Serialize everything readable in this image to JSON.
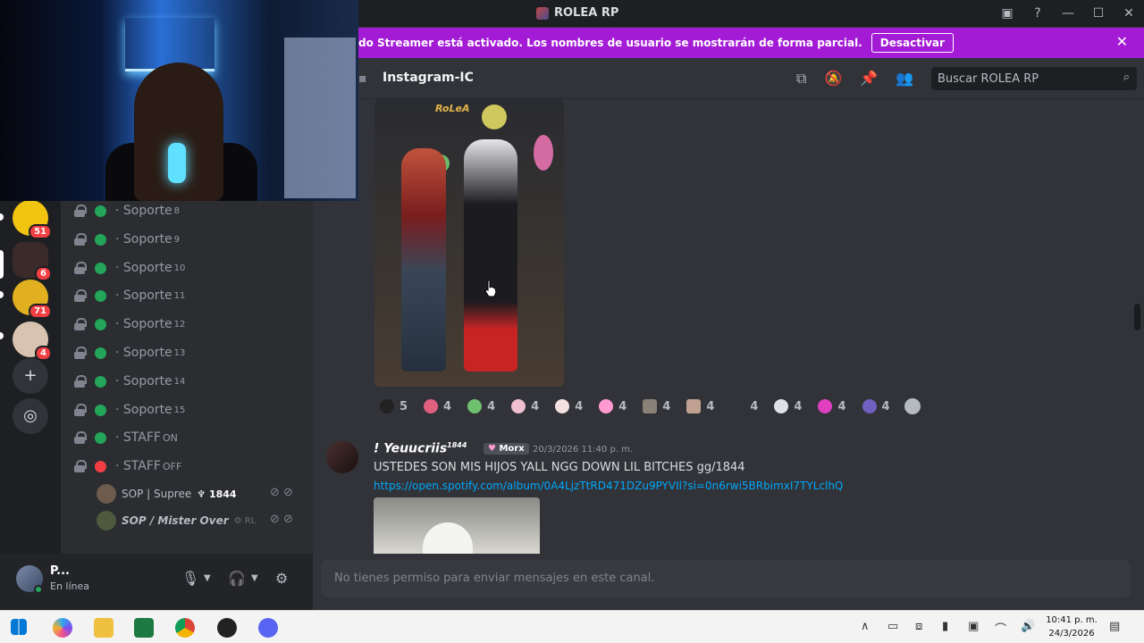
{
  "window": {
    "title": "ROLEA RP",
    "controls": [
      "screen-share-icon",
      "help-icon",
      "minimize-icon",
      "maximize-icon",
      "close-icon"
    ]
  },
  "banner": {
    "text": "do Streamer está activado. Los nombres de usuario se mostrarán de forma parcial.",
    "button": "Desactivar",
    "close": "✕"
  },
  "servers": [
    {
      "badge": "51"
    },
    {
      "badge": "6"
    },
    {
      "badge": "71"
    },
    {
      "badge": "4"
    }
  ],
  "channels": [
    {
      "name": "Soporte",
      "num": "8",
      "status": "online"
    },
    {
      "name": "Soporte",
      "num": "9",
      "status": "online"
    },
    {
      "name": "Soporte",
      "num": "10",
      "status": "online"
    },
    {
      "name": "Soporte",
      "num": "11",
      "status": "online"
    },
    {
      "name": "Soporte",
      "num": "12",
      "status": "online"
    },
    {
      "name": "Soporte",
      "num": "13",
      "status": "online"
    },
    {
      "name": "Soporte",
      "num": "14",
      "status": "online"
    },
    {
      "name": "Soporte",
      "num": "15",
      "status": "online"
    },
    {
      "name": "STAFF",
      "num": "ON",
      "status": "online"
    },
    {
      "name": "STAFF",
      "num": "OFF",
      "status": "offline"
    }
  ],
  "voice_users": [
    {
      "name": "SOP | Supree",
      "tag": "1844"
    },
    {
      "name": "SOP / Mister Over",
      "tag": "RL"
    }
  ],
  "user_panel": {
    "name": "P...",
    "status": "En línea"
  },
  "chat": {
    "channel": "Instagram-IC",
    "search_placeholder": "Buscar ROLEA RP",
    "image_logo": "RoLeA"
  },
  "reactions": [
    "5",
    "4",
    "4",
    "4",
    "4",
    "4",
    "4",
    "4",
    "4",
    "4",
    "4",
    "4"
  ],
  "message": {
    "author": "! Yeuucriis",
    "author_sup": "1844",
    "role": "Morx",
    "time": "20/3/2026 11:40 p. m.",
    "text": "USTEDES SON MIS HIJOS YALL NGG DOWN LIL BITCHES gg/1844",
    "link": "https://open.spotify.com/album/0A4LjzTtRD471DZu9PYVIl?si=0n6rwi5BRbimxI7TYLclhQ"
  },
  "composer": {
    "placeholder": "No tienes permiso para enviar mensajes en este canal."
  },
  "taskbar": {
    "time": "10:41 p. m.",
    "date": "24/3/2026"
  },
  "colors": {
    "online": "#23a55a",
    "offline": "#f23f43",
    "banner": "#a41bd6",
    "link": "#00a8fc"
  }
}
